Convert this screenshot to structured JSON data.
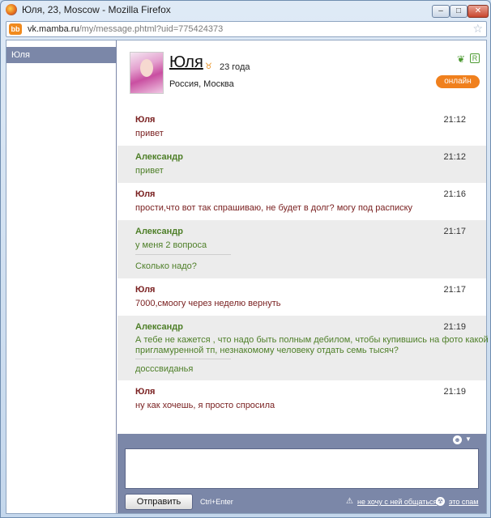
{
  "window": {
    "title": "Юля, 23, Moscow - Mozilla Firefox",
    "url_domain": "vk.mamba.ru",
    "url_path": "/my/message.phtml?uid=775424373",
    "site_icon_label": "bb",
    "icons": [
      "firefox-icon",
      "star-icon"
    ]
  },
  "sidebar": {
    "items": [
      {
        "label": "Юля",
        "selected": true
      }
    ]
  },
  "profile": {
    "name": "Юля",
    "age": "23 года",
    "location": "Россия, Москва",
    "r_badge": "R",
    "status": "онлайн",
    "accent_color": "#f0801d"
  },
  "messages": [
    {
      "author": "Юля",
      "time": "21:12",
      "text": "привет",
      "side": "her"
    },
    {
      "author": "Александр",
      "time": "21:12",
      "text": "привет",
      "side": "him"
    },
    {
      "author": "Юля",
      "time": "21:16",
      "text": "прости,что вот так спрашиваю, не будет в долг? могу под расписку",
      "side": "her"
    },
    {
      "author": "Александр",
      "time": "21:17",
      "text": "у меня 2 вопроса",
      "text2": "Сколько надо?",
      "side": "him"
    },
    {
      "author": "Юля",
      "time": "21:17",
      "text": "7000,смоогу через неделю вернуть",
      "side": "her"
    },
    {
      "author": "Александр",
      "time": "21:19",
      "text": "А тебе не кажется , что надо быть полным дебилом, чтобы купившись на фото какой то",
      "text_line2": "пригламуренной тп, незнакомому человеку отдать семь тысяч?",
      "text2": "досссвиданья",
      "side": "him"
    },
    {
      "author": "Юля",
      "time": "21:19",
      "text": "ну как хочешь, я просто спросила",
      "side": "her"
    }
  ],
  "composer": {
    "send_label": "Отправить",
    "hint": "Ctrl+Enter",
    "no_chat": "не хочу с ней общаться",
    "spam": "это спам",
    "panel_color": "#7b87a8"
  }
}
